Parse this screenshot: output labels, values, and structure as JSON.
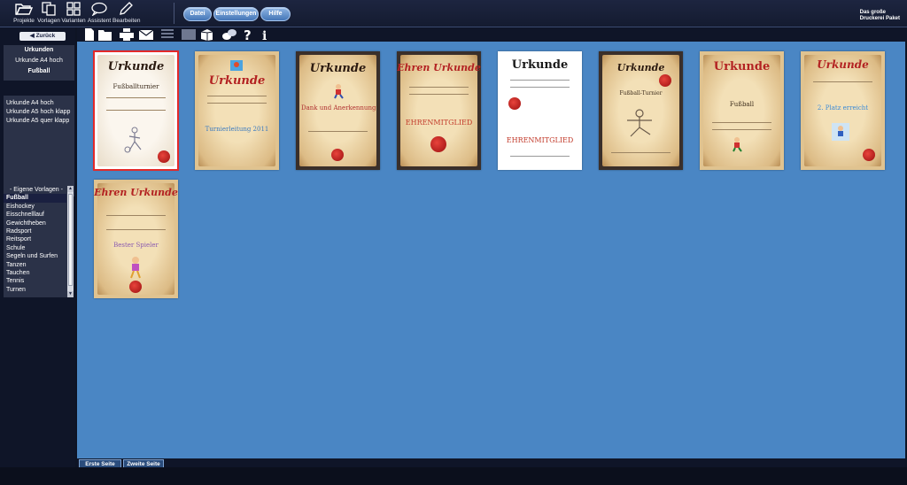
{
  "toolbar": {
    "items": [
      {
        "label": "Projekte",
        "icon": "folder-open-icon"
      },
      {
        "label": "Vorlagen",
        "icon": "copy-icon"
      },
      {
        "label": "Varianten",
        "icon": "grid-icon"
      },
      {
        "label": "Assistent",
        "icon": "speech-bubble-icon"
      },
      {
        "label": "Bearbeiten",
        "icon": "pen-icon"
      }
    ],
    "menu": [
      "Datei",
      "Einstellungen",
      "Hilfe"
    ],
    "brand_line1": "Das große",
    "brand_line2": "Druckerei Paket"
  },
  "sidebar": {
    "back_label": "Zurück",
    "categories": [
      {
        "label": "Urkunden",
        "selected": true
      },
      {
        "label": "Urkunde A4 hoch",
        "selected": false
      },
      {
        "label": "Fußball",
        "selected": true
      }
    ],
    "subitems": [
      "Urkunde A4 hoch",
      "Urkunde A5 hoch klapp",
      "Urkunde A5 quer klapp"
    ],
    "templates_header": "- Eigene Vorlagen -",
    "templates": [
      "Fußball",
      "Eishockey",
      "Eisschnelllauf",
      "Gewichtheben",
      "Radsport",
      "Reitsport",
      "Schule",
      "Segeln und Surfen",
      "Tanzen",
      "Tauchen",
      "Tennis",
      "Turnen"
    ],
    "selected_template": "Fußball"
  },
  "icon_toolbar": [
    "new-document-icon",
    "open-folder-icon",
    "print-icon",
    "email-icon",
    "list-icon",
    "image-icon",
    "cube-icon",
    "chat-icon",
    "help-icon",
    "info-icon"
  ],
  "thumbnails": [
    {
      "title": "Urkunde",
      "text": "Fußballturnier",
      "selected": true,
      "dark": false
    },
    {
      "title": "Urkunde",
      "text": "Turnierleitung 2011",
      "selected": false,
      "dark": false
    },
    {
      "title": "Urkunde",
      "text": "Dank und Anerkennung",
      "selected": false,
      "dark": true
    },
    {
      "title": "Ehren Urkunde",
      "text": "EHRENMITGLIED",
      "selected": false,
      "dark": true
    },
    {
      "title": "Urkunde",
      "text": "EHRENMITGLIED",
      "selected": false,
      "dark": false,
      "white": true
    },
    {
      "title": "Urkunde",
      "text": "Fußball-Turnier",
      "selected": false,
      "dark": true
    },
    {
      "title": "Urkunde",
      "text": "Fußball",
      "selected": false,
      "dark": false
    },
    {
      "title": "Urkunde",
      "text": "2. Platz erreicht",
      "selected": false,
      "dark": false
    },
    {
      "title": "Ehren Urkunde",
      "text": "Bester Spieler",
      "selected": false,
      "dark": false
    }
  ],
  "tabs": [
    "Erste Seite",
    "Zweite Seite"
  ]
}
